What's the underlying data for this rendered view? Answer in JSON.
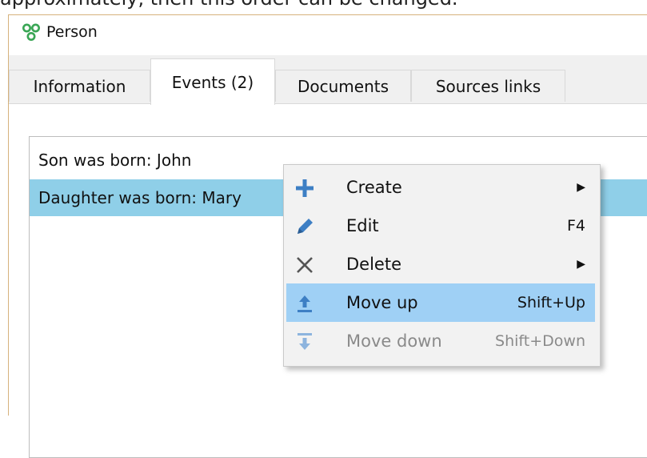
{
  "doc_caption": "approximately, then this order can be changed.",
  "window": {
    "title": "Person"
  },
  "tabs": [
    {
      "label": "Information",
      "active": false
    },
    {
      "label": "Events (2)",
      "active": true
    },
    {
      "label": "Documents",
      "active": false
    },
    {
      "label": "Sources links",
      "active": false
    }
  ],
  "events_list": [
    {
      "text": "Son was born: John",
      "selected": false
    },
    {
      "text": "Daughter was born: Mary",
      "selected": true
    }
  ],
  "context_menu": {
    "items": [
      {
        "label": "Create",
        "shortcut": "",
        "submenu": true,
        "icon": "plus-icon",
        "state": "normal"
      },
      {
        "label": "Edit",
        "shortcut": "F4",
        "submenu": false,
        "icon": "pencil-icon",
        "state": "normal"
      },
      {
        "label": "Delete",
        "shortcut": "",
        "submenu": true,
        "icon": "cross-icon",
        "state": "normal"
      },
      {
        "label": "Move up",
        "shortcut": "Shift+Up",
        "submenu": false,
        "icon": "move-up-icon",
        "state": "highlighted"
      },
      {
        "label": "Move down",
        "shortcut": "Shift+Down",
        "submenu": false,
        "icon": "move-down-icon",
        "state": "disabled"
      }
    ],
    "submenu_glyph": "▶"
  },
  "colors": {
    "selection": "#8fcfe8",
    "menu_highlight": "#9fd0f5",
    "icon_blue": "#3d7fc4",
    "app_icon_green": "#3aa655"
  }
}
